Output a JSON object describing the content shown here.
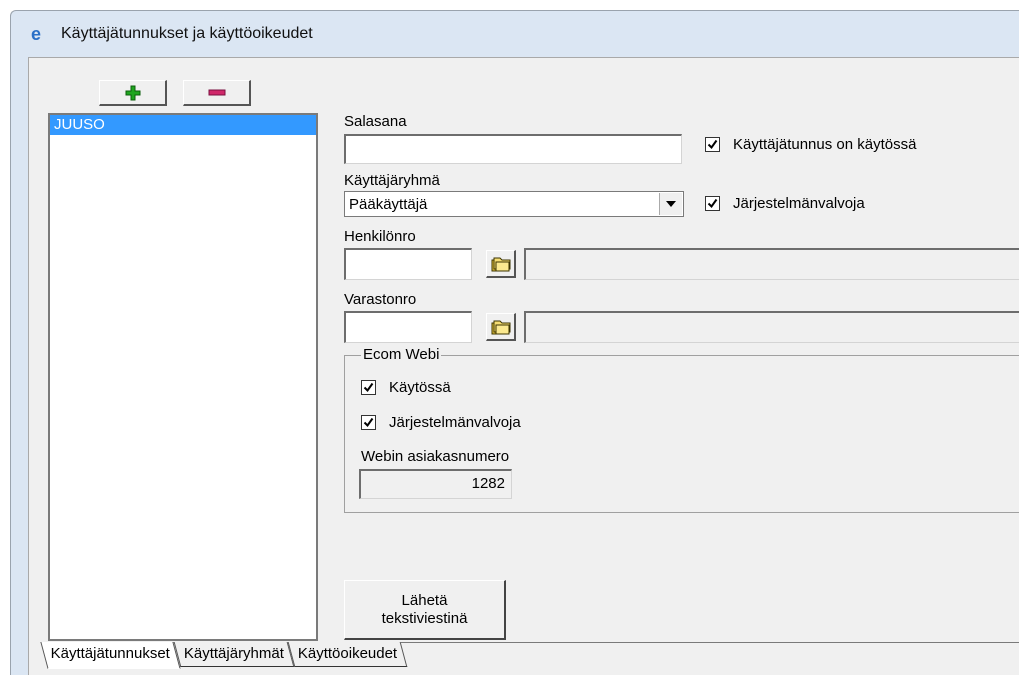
{
  "window": {
    "title": "Käyttäjätunnukset ja käyttöoikeudet",
    "icon": "app-e-icon"
  },
  "toolbar": {
    "add_icon": "plus-icon",
    "remove_icon": "minus-icon",
    "add_color": "#1fa51f",
    "remove_color": "#d0286a"
  },
  "users": [
    "JUUSO"
  ],
  "form": {
    "password_label": "Salasana",
    "password_value": "",
    "account_enabled_label": "Käyttäjätunnus on käytössä",
    "account_enabled_checked": true,
    "group_label": "Käyttäjäryhmä",
    "group_value": "Pääkäyttäjä",
    "sysadmin_label": "Järjestelmänvalvoja",
    "sysadmin_checked": true,
    "person_label": "Henkilönro",
    "person_value": "",
    "person_name": "",
    "warehouse_label": "Varastonro",
    "warehouse_value": "",
    "warehouse_name": ""
  },
  "ecom": {
    "title": "Ecom Webi",
    "enabled_label": "Käytössä",
    "enabled_checked": true,
    "admin_label": "Järjestelmänvalvoja",
    "admin_checked": true,
    "customer_label": "Webin asiakasnumero",
    "customer_value": "1282"
  },
  "send_button": {
    "line1": "Lähetä",
    "line2": "tekstiviestinä"
  },
  "tabs": [
    "Käyttäjätunnukset",
    "Käyttäjäryhmät",
    "Käyttöoikeudet"
  ],
  "active_tab": 0
}
